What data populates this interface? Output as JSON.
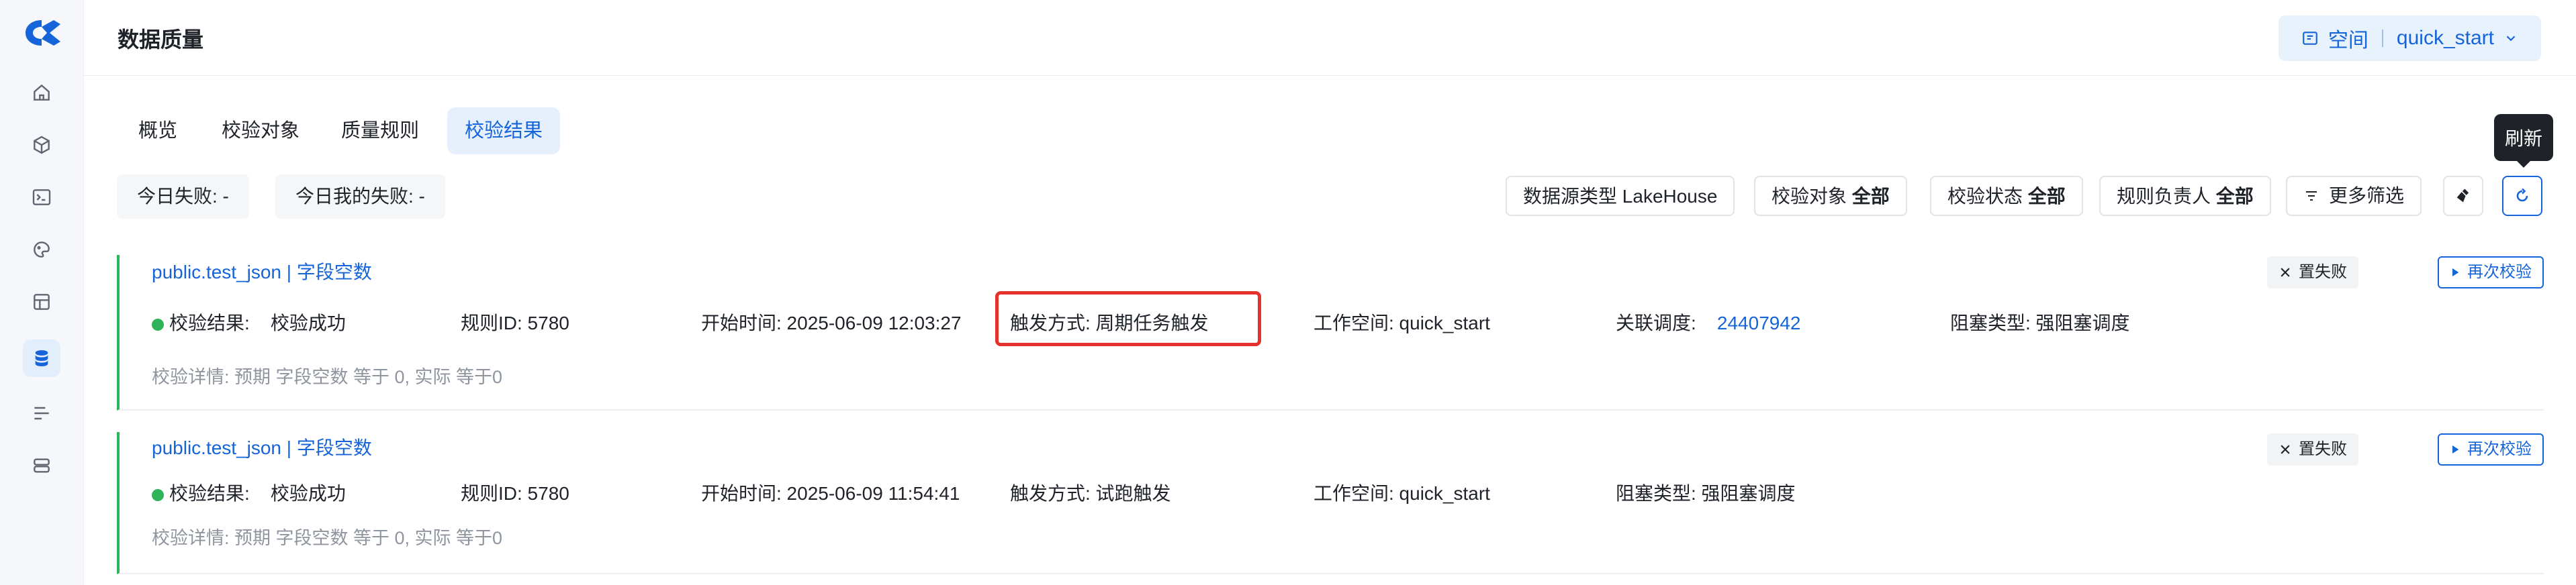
{
  "page": {
    "title": "数据质量"
  },
  "workspace": {
    "label": "空间",
    "value": "quick_start"
  },
  "rail_icons": [
    "logo",
    "home-icon",
    "cube-icon",
    "terminal-icon",
    "palette-icon",
    "table-icon",
    "database-icon",
    "list-icon",
    "server-icon"
  ],
  "tabs": [
    {
      "label": "概览",
      "active": false
    },
    {
      "label": "校验对象",
      "active": false
    },
    {
      "label": "质量规则",
      "active": false
    },
    {
      "label": "校验结果",
      "active": true
    }
  ],
  "summary": {
    "today_fail": "今日失败: -",
    "my_today_fail": "今日我的失败: -"
  },
  "filters": {
    "datasource": {
      "label": "数据源类型",
      "value": "LakeHouse"
    },
    "object": {
      "label": "校验对象",
      "value": "全部"
    },
    "status": {
      "label": "校验状态",
      "value": "全部"
    },
    "owner": {
      "label": "规则负责人",
      "value": "全部"
    },
    "more": "更多筛选"
  },
  "tooltip": "刷新",
  "results": [
    {
      "title": "public.test_json | 字段空数",
      "result_label": "校验结果:",
      "result_value": "校验成功",
      "rule_id": "规则ID: 5780",
      "start_time": "开始时间: 2025-06-09 12:03:27",
      "trigger": "触发方式: 周期任务触发",
      "workspace": "工作空间: quick_start",
      "schedule_label": "关联调度:",
      "schedule_value": "24407942",
      "block_type": "阻塞类型: 强阻塞调度",
      "detail": "校验详情: 预期 字段空数 等于 0, 实际 等于0",
      "btn_fail": "置失败",
      "btn_recheck": "再次校验"
    },
    {
      "title": "public.test_json | 字段空数",
      "result_label": "校验结果:",
      "result_value": "校验成功",
      "rule_id": "规则ID: 5780",
      "start_time": "开始时间: 2025-06-09 11:54:41",
      "trigger": "触发方式: 试跑触发",
      "workspace": "工作空间: quick_start",
      "block_type": "阻塞类型: 强阻塞调度",
      "detail": "校验详情: 预期 字段空数 等于 0, 实际 等于0",
      "btn_fail": "置失败",
      "btn_recheck": "再次校验"
    }
  ],
  "colors": {
    "accent": "#1664d9",
    "success": "#2fb35a",
    "highlight": "#e5322d"
  }
}
